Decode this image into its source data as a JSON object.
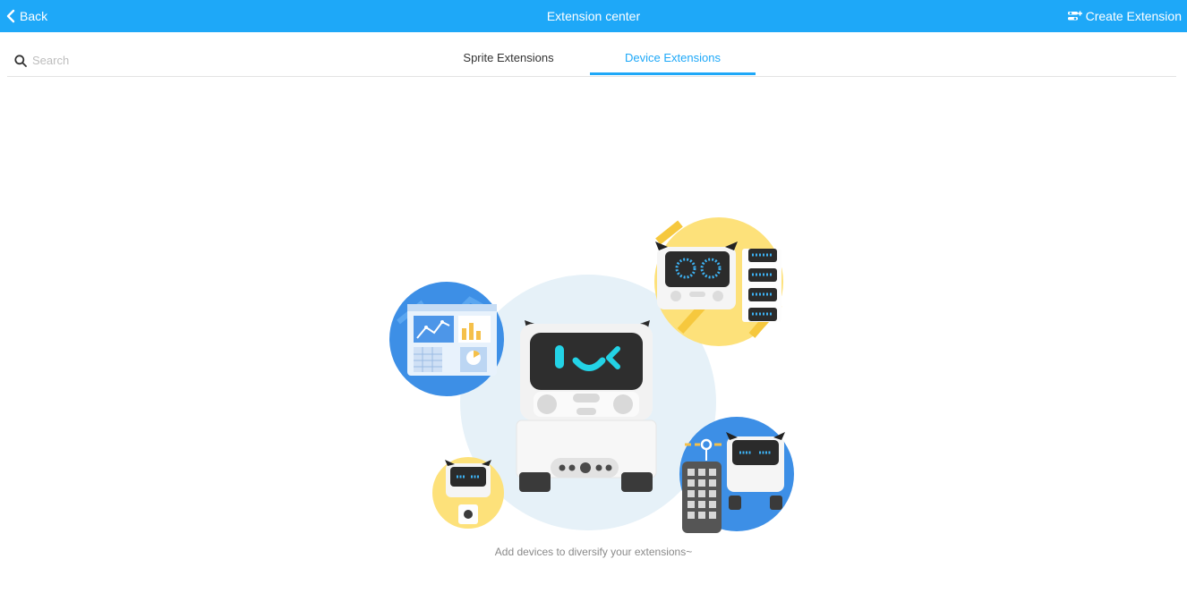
{
  "header": {
    "back_label": "Back",
    "title": "Extension center",
    "create_label": "Create Extension",
    "color": "#1ea8f8"
  },
  "search": {
    "placeholder": "Search"
  },
  "tabs": [
    {
      "label": "Sprite Extensions",
      "active": false
    },
    {
      "label": "Device Extensions",
      "active": true
    }
  ],
  "empty_state": {
    "message": "Add devices to diversify your extensions~",
    "illustration": "robot-devices-illustration"
  }
}
